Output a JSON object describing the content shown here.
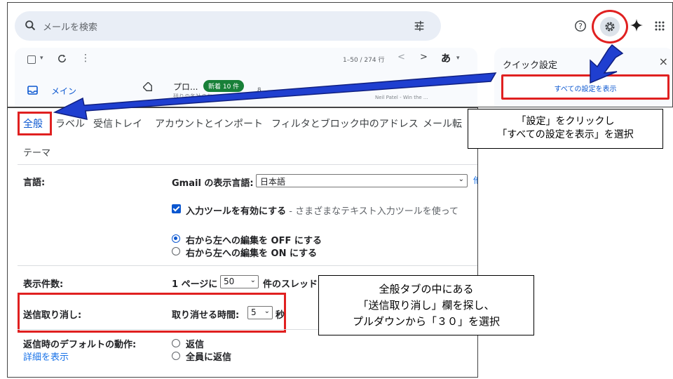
{
  "header": {
    "search_placeholder": "メールを検索",
    "icons": [
      "search-icon",
      "tune-icon",
      "help-icon",
      "gear-icon",
      "sparkle-icon",
      "apps-icon"
    ]
  },
  "toolbar": {
    "paging": "1–50 / 274 行",
    "prev": "<",
    "next": ">",
    "ime": "あ"
  },
  "tabs_top": {
    "main_label": "メイン",
    "promo_label": "プロ...",
    "promo_badge": "新着 10 件",
    "promo_snippet": "残りの各社のお...",
    "sender_snippet": "Neil Patel - Win the ..."
  },
  "quick_settings": {
    "title": "クイック設定",
    "close": "×",
    "see_all": "すべての設定を表示"
  },
  "settings": {
    "tabs": [
      "全般",
      "ラベル",
      "受信トレイ",
      "アカウントとインポート",
      "フィルタとブロック中のアドレス",
      "メール転"
    ],
    "theme_tab": "テーマ",
    "language": {
      "label": "言語:",
      "display_label": "Gmail の表示言語:",
      "value": "日本語",
      "more": "他",
      "input_tools": "入力ツールを有効にする",
      "input_tools_desc": " - さまざまなテキスト入力ツールを使って",
      "rtl_off": "右から左への編集を OFF にする",
      "rtl_on": "右から左への編集を ON にする"
    },
    "page_size": {
      "label": "表示件数:",
      "prefix": "1 ページに",
      "value": "50",
      "suffix": "件のスレッドを表示"
    },
    "undo_send": {
      "label": "送信取り消し:",
      "prefix": "取り消せる時間:",
      "value": "5",
      "suffix": "秒"
    },
    "reply_default": {
      "label": "返信時のデフォルトの動作:",
      "details_link": "詳細を表示",
      "option_reply": "返信",
      "option_reply_all": "全員に返信"
    }
  },
  "callouts": {
    "c1_line1": "「設定」をクリックし",
    "c1_line2": "「すべての設定を表示」を選択",
    "c2_line1": "全般タブの中にある",
    "c2_line2": "「送信取り消し」欄を探し、",
    "c2_line3": "プルダウンから「３０」を選択"
  },
  "colors": {
    "highlight_red": "#e02020",
    "arrow_blue": "#1f3fd0",
    "link_blue": "#0b57d0"
  }
}
